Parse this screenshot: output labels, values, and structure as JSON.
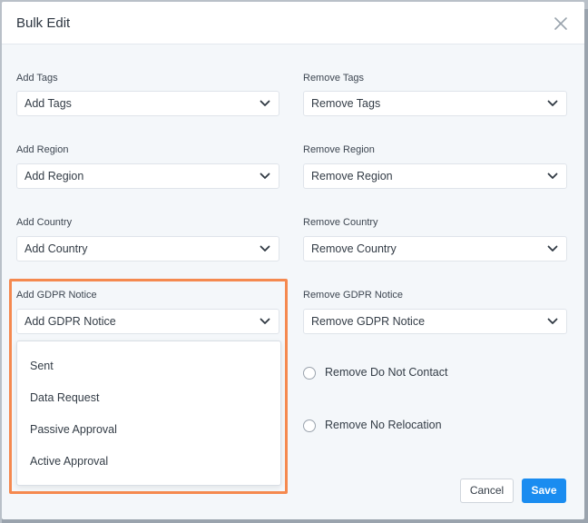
{
  "modal": {
    "title": "Bulk Edit",
    "close_icon": "close-icon"
  },
  "fields": {
    "add_tags": {
      "label": "Add Tags",
      "placeholder": "Add Tags"
    },
    "remove_tags": {
      "label": "Remove Tags",
      "placeholder": "Remove Tags"
    },
    "add_region": {
      "label": "Add Region",
      "placeholder": "Add Region"
    },
    "remove_region": {
      "label": "Remove Region",
      "placeholder": "Remove Region"
    },
    "add_country": {
      "label": "Add Country",
      "placeholder": "Add Country"
    },
    "remove_country": {
      "label": "Remove Country",
      "placeholder": "Remove Country"
    },
    "add_gdpr": {
      "label": "Add GDPR Notice",
      "placeholder": "Add GDPR Notice"
    },
    "remove_gdpr": {
      "label": "Remove GDPR Notice",
      "placeholder": "Remove GDPR Notice"
    }
  },
  "gdpr_dropdown": {
    "expanded": true,
    "options": [
      "Sent",
      "Data Request",
      "Passive Approval",
      "Active Approval"
    ]
  },
  "radios": {
    "remove_do_not_contact": {
      "label": "Remove Do Not Contact",
      "checked": false
    },
    "remove_no_relocation": {
      "label": "Remove No Relocation",
      "checked": false
    }
  },
  "actions": {
    "cancel_label": "Cancel",
    "save_label": "Save"
  },
  "colors": {
    "primary": "#1a8cf0",
    "highlight": "#f5894f",
    "modal_background": "#f4f7fa"
  }
}
